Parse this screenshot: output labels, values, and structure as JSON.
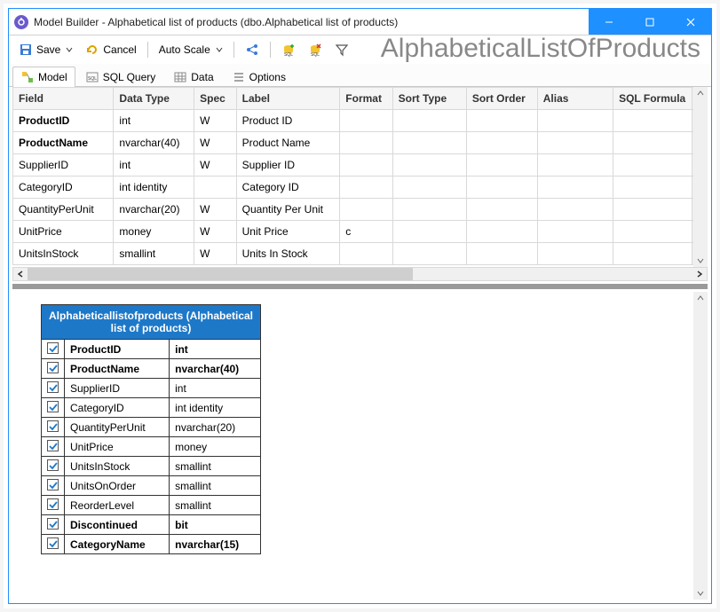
{
  "window": {
    "title": "Model Builder - Alphabetical list of products (dbo.Alphabetical list of products)"
  },
  "toolbar": {
    "save_label": "Save",
    "cancel_label": "Cancel",
    "autoscale_label": "Auto Scale"
  },
  "tabs": {
    "model": "Model",
    "sql_query": "SQL Query",
    "data": "Data",
    "options": "Options"
  },
  "big_title": "AlphabeticalListOfProducts",
  "grid": {
    "headers": {
      "field": "Field",
      "datatype": "Data Type",
      "spec": "Spec",
      "label": "Label",
      "format": "Format",
      "sorttype": "Sort Type",
      "sortorder": "Sort Order",
      "alias": "Alias",
      "sqlformula": "SQL Formula"
    },
    "rows": [
      {
        "field": "ProductID",
        "datatype": "int",
        "spec": "W",
        "label": "Product ID",
        "format": "",
        "bold": true
      },
      {
        "field": "ProductName",
        "datatype": "nvarchar(40)",
        "spec": "W",
        "label": "Product Name",
        "format": "",
        "bold": true
      },
      {
        "field": "SupplierID",
        "datatype": "int",
        "spec": "W",
        "label": "Supplier ID",
        "format": "",
        "bold": false
      },
      {
        "field": "CategoryID",
        "datatype": "int identity",
        "spec": "",
        "label": "Category ID",
        "format": "",
        "bold": false
      },
      {
        "field": "QuantityPerUnit",
        "datatype": "nvarchar(20)",
        "spec": "W",
        "label": "Quantity Per Unit",
        "format": "",
        "bold": false
      },
      {
        "field": "UnitPrice",
        "datatype": "money",
        "spec": "W",
        "label": "Unit Price",
        "format": "c",
        "bold": false
      },
      {
        "field": "UnitsInStock",
        "datatype": "smallint",
        "spec": "W",
        "label": "Units In Stock",
        "format": "",
        "bold": false
      }
    ]
  },
  "entity": {
    "header": "Alphabeticallistofproducts (Alphabetical list of products)",
    "rows": [
      {
        "name": "ProductID",
        "type": "int",
        "bold": true
      },
      {
        "name": "ProductName",
        "type": "nvarchar(40)",
        "bold": true
      },
      {
        "name": "SupplierID",
        "type": "int",
        "bold": false
      },
      {
        "name": "CategoryID",
        "type": "int identity",
        "bold": false
      },
      {
        "name": "QuantityPerUnit",
        "type": "nvarchar(20)",
        "bold": false
      },
      {
        "name": "UnitPrice",
        "type": "money",
        "bold": false
      },
      {
        "name": "UnitsInStock",
        "type": "smallint",
        "bold": false
      },
      {
        "name": "UnitsOnOrder",
        "type": "smallint",
        "bold": false
      },
      {
        "name": "ReorderLevel",
        "type": "smallint",
        "bold": false
      },
      {
        "name": "Discontinued",
        "type": "bit",
        "bold": true
      },
      {
        "name": "CategoryName",
        "type": "nvarchar(15)",
        "bold": true
      }
    ]
  }
}
